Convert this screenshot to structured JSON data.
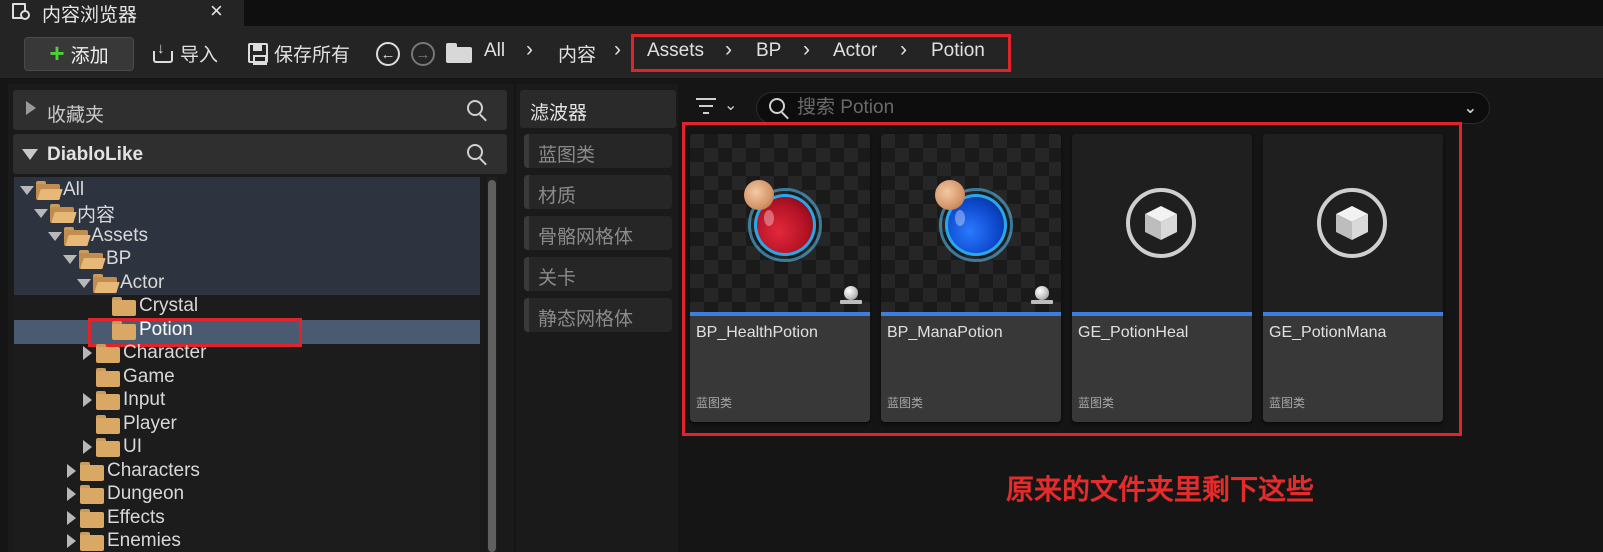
{
  "tab": {
    "title": "内容浏览器",
    "close": "×"
  },
  "toolbar": {
    "add_label": "添加",
    "add_icon": "plus-icon",
    "import_label": "导入",
    "save_all_label": "保存所有"
  },
  "breadcrumb": {
    "items": [
      "All",
      "内容",
      "Assets",
      "BP",
      "Actor",
      "Potion"
    ],
    "separator": "›"
  },
  "favorites": {
    "label": "收藏夹"
  },
  "project": {
    "label": "DiabloLike"
  },
  "tree": [
    {
      "label": "All"
    },
    {
      "label": "内容"
    },
    {
      "label": "Assets"
    },
    {
      "label": "BP"
    },
    {
      "label": "Actor"
    },
    {
      "label": "Crystal"
    },
    {
      "label": "Potion"
    },
    {
      "label": "Character"
    },
    {
      "label": "Game"
    },
    {
      "label": "Input"
    },
    {
      "label": "Player"
    },
    {
      "label": "UI"
    },
    {
      "label": "Characters"
    },
    {
      "label": "Dungeon"
    },
    {
      "label": "Effects"
    },
    {
      "label": "Enemies"
    }
  ],
  "filters": {
    "title": "滤波器",
    "items": [
      "蓝图类",
      "材质",
      "骨骼网格体",
      "关卡",
      "静态网格体"
    ]
  },
  "search": {
    "placeholder": "搜索 Potion"
  },
  "assets": [
    {
      "name": "BP_HealthPotion",
      "type": "蓝图类",
      "thumbnail": "health-potion-icon"
    },
    {
      "name": "BP_ManaPotion",
      "type": "蓝图类",
      "thumbnail": "mana-potion-icon"
    },
    {
      "name": "GE_PotionHeal",
      "type": "蓝图类",
      "thumbnail": "cube-icon"
    },
    {
      "name": "GE_PotionMana",
      "type": "蓝图类",
      "thumbnail": "cube-icon"
    }
  ],
  "annotation": "原来的文件夹里剩下这些",
  "colors": {
    "highlight_red": "#e0242c",
    "accent_blue": "#3d7fe0",
    "selected_row": "#4a5a70",
    "folder": "#d9a865",
    "add_green": "#4cd137"
  }
}
